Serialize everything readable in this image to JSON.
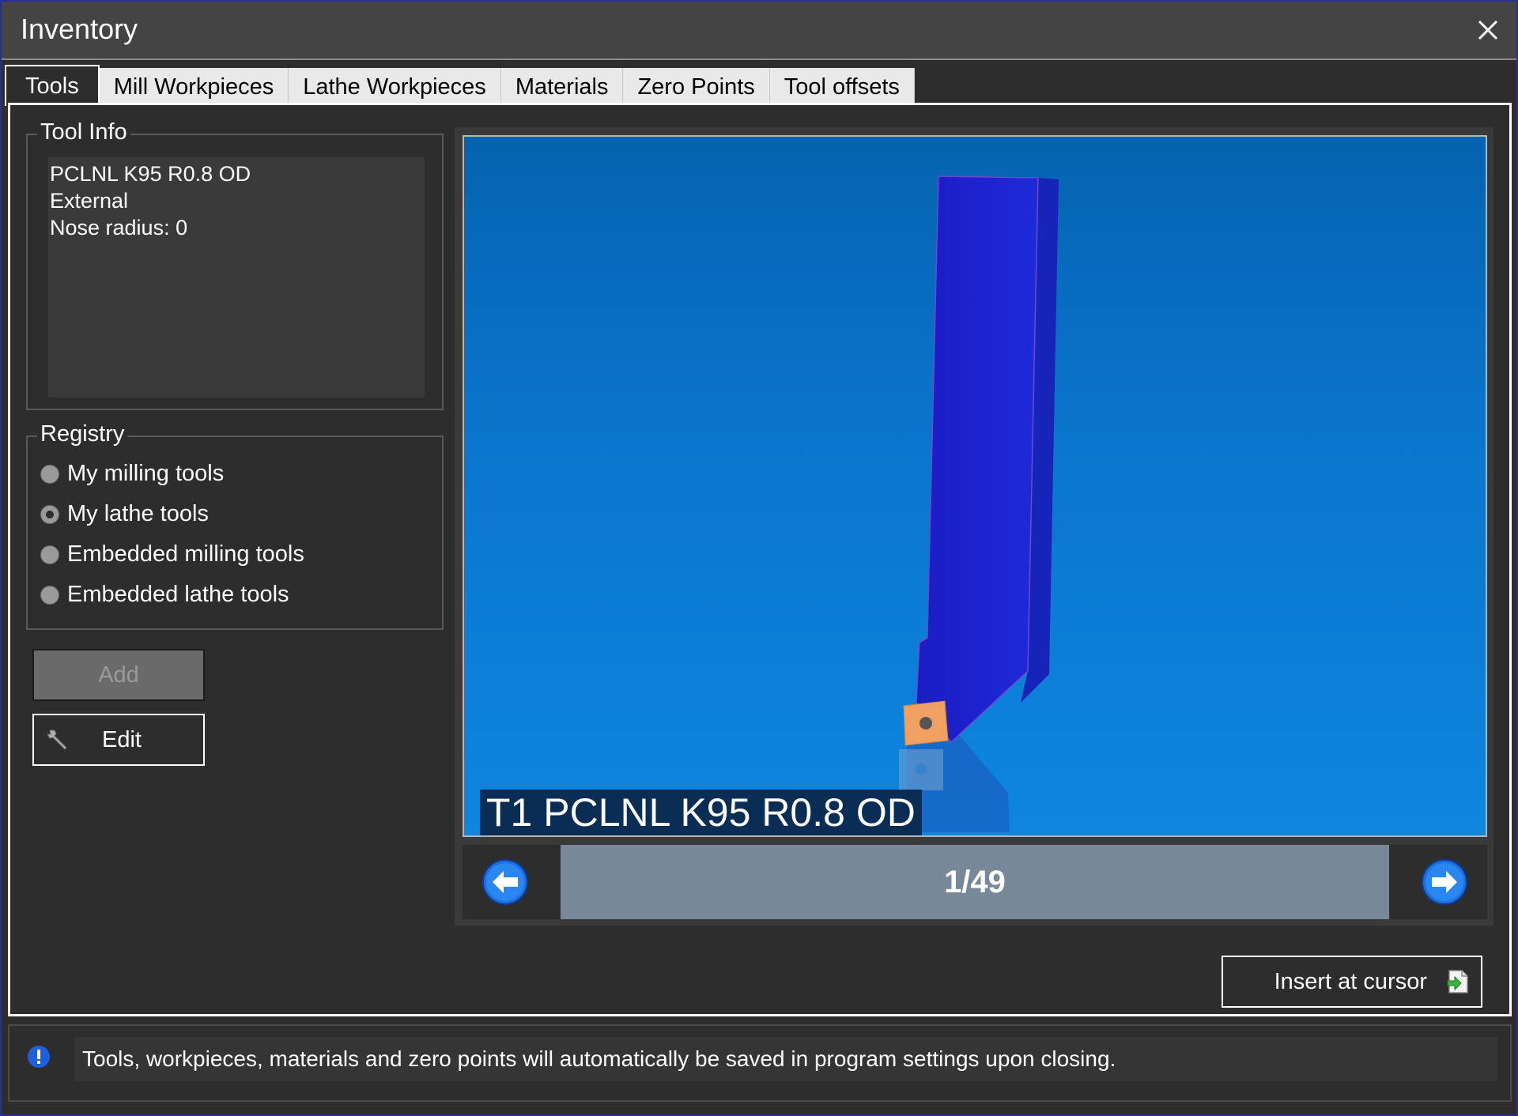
{
  "window": {
    "title": "Inventory"
  },
  "tabs": [
    {
      "label": "Tools",
      "active": true
    },
    {
      "label": "Mill Workpieces",
      "active": false
    },
    {
      "label": "Lathe Workpieces",
      "active": false
    },
    {
      "label": "Materials",
      "active": false
    },
    {
      "label": "Zero Points",
      "active": false
    },
    {
      "label": "Tool offsets",
      "active": false
    }
  ],
  "tool_info": {
    "title": "Tool Info",
    "lines": [
      "PCLNL K95 R0.8 OD",
      "External",
      "Nose radius: 0"
    ]
  },
  "registry": {
    "title": "Registry",
    "options": [
      {
        "label": "My milling tools",
        "selected": false
      },
      {
        "label": "My lathe tools",
        "selected": true
      },
      {
        "label": "Embedded milling tools",
        "selected": false
      },
      {
        "label": "Embedded lathe tools",
        "selected": false
      }
    ]
  },
  "buttons": {
    "add": "Add",
    "edit": "Edit",
    "insert": "Insert at cursor"
  },
  "preview": {
    "caption": "T1 PCLNL K95 R0.8 OD",
    "counter": "1/49"
  },
  "status": {
    "message": "Tools, workpieces, materials and zero points will automatically be saved in program settings upon closing."
  },
  "icons": {
    "close": "close-icon",
    "edit": "wrench-icon",
    "insert": "insert-document-icon",
    "prev": "arrow-left-icon",
    "next": "arrow-right-icon",
    "info": "info-icon"
  },
  "colors": {
    "window_bg": "#2d2d2d",
    "titlebar_bg": "#444444",
    "viewport_blue": "#0a74cc",
    "tool_body": "#1a1ac8",
    "insert_orange": "#f0a060",
    "counter_bg": "#778899"
  }
}
